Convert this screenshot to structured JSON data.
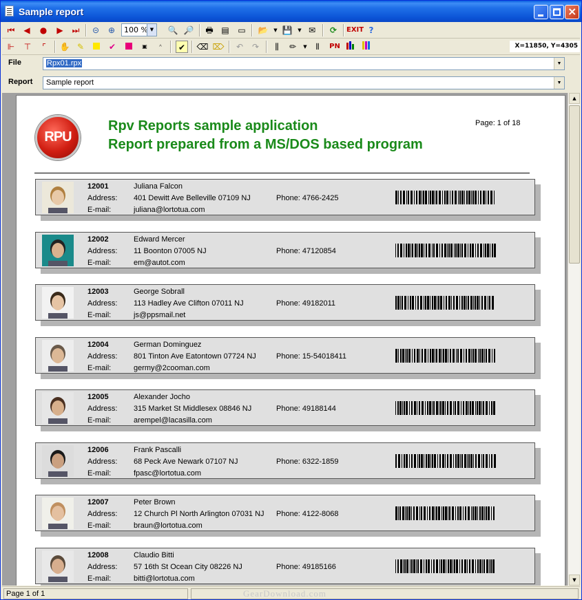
{
  "window": {
    "title": "Sample report"
  },
  "toolbar": {
    "zoom": "100 %",
    "exit_label": "EXIT",
    "help_label": "?",
    "pn_label": "PN",
    "coords": "X=11850, Y=4305"
  },
  "fields": {
    "file_label": "File",
    "file_value": "Rpx01.rpx",
    "report_label": "Report",
    "report_value": "Sample report"
  },
  "report": {
    "logo_text": "RPU",
    "title_line1": "Rpv Reports sample application",
    "title_line2": "Report prepared from a MS/DOS based program",
    "page_label": "Page:  1 of 18",
    "address_label": "Address:",
    "email_label": "E-mail:",
    "records": [
      {
        "id": "12001",
        "name": "Juliana Falcon",
        "address": "401 Dewitt Ave Belleville 07109 NJ",
        "phone": "Phone: 4766-2425",
        "email": "juliana@lortotua.com"
      },
      {
        "id": "12002",
        "name": "Edward Mercer",
        "address": "11 Boonton 07005 NJ",
        "phone": "Phone: 47120854",
        "email": "em@autot.com"
      },
      {
        "id": "12003",
        "name": "George Sobrall",
        "address": "113 Hadley Ave Clifton 07011 NJ",
        "phone": "Phone: 49182011",
        "email": "js@ppsmail.net"
      },
      {
        "id": "12004",
        "name": "German Dominguez",
        "address": "801 Tinton Ave Eatontown 07724 NJ",
        "phone": "Phone: 15-54018411",
        "email": "germy@2cooman.com"
      },
      {
        "id": "12005",
        "name": "Alexander Jocho",
        "address": "315 Market St Middlesex 08846 NJ",
        "phone": "Phone: 49188144",
        "email": "arempel@lacasilla.com"
      },
      {
        "id": "12006",
        "name": "Frank Pascalli",
        "address": "68 Peck Ave Newark 07107 NJ",
        "phone": "Phone: 6322-1859",
        "email": "fpasc@lortotua.com"
      },
      {
        "id": "12007",
        "name": "Peter Brown",
        "address": "12 Church Pl North Arlington 07031 NJ",
        "phone": "Phone: 4122-8068",
        "email": "braun@lortotua.com"
      },
      {
        "id": "12008",
        "name": "Claudio Bitti",
        "address": "57 16th St Ocean City 08226 NJ",
        "phone": "Phone: 49185166",
        "email": "bitti@lortotua.com"
      }
    ]
  },
  "status": {
    "page_text": "Page 1 of 1",
    "watermark": "GearDownload.com"
  },
  "colors": {
    "title_green": "#1a8a1a",
    "titlebar_blue": "#0b53d6",
    "accent_red": "#c00000"
  },
  "icons": [
    "first-page-icon",
    "prev-page-icon",
    "stop-icon",
    "next-page-icon",
    "last-page-icon",
    "zoom-out-icon",
    "zoom-in-icon",
    "find-icon",
    "find-next-icon",
    "print-icon",
    "print-setup-icon",
    "page-setup-icon",
    "open-icon",
    "save-icon",
    "export-icon",
    "refresh-icon",
    "help-icon"
  ]
}
